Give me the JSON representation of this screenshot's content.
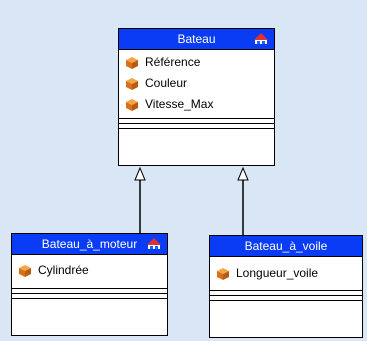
{
  "classes": {
    "bateau": {
      "name": "Bateau",
      "attributes": [
        "Référence",
        "Couleur",
        "Vitesse_Max"
      ]
    },
    "moteur": {
      "name": "Bateau_à_moteur",
      "attributes": [
        "Cylindrée"
      ]
    },
    "voile": {
      "name": "Bateau_à_voile",
      "attributes": [
        "Longueur_voile"
      ]
    }
  },
  "colors": {
    "header": "#0a3cf5",
    "background": "#d9e6f5",
    "attribute_icon": "#e8801a"
  },
  "icons": {
    "attribute": "cube-icon",
    "stereotype": "class-stereotype-icon"
  }
}
